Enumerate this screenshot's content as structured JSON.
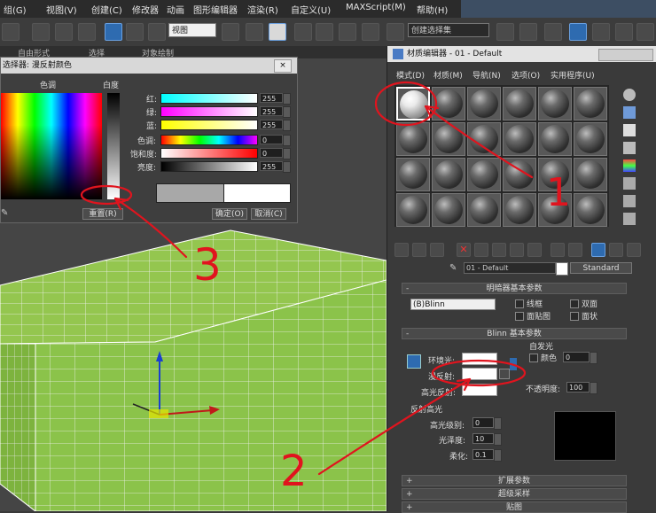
{
  "menubar": {
    "items": [
      "组(G)",
      "视图(V)",
      "创建(C)",
      "修改器",
      "动画",
      "图形编辑器",
      "渲染(R)",
      "自定义(U)",
      "MAXScript(M)",
      "帮助(H)"
    ]
  },
  "toolbar": {
    "view_combo": "视图",
    "selection_set_combo": "创建选择集"
  },
  "subbar": {
    "items": [
      "自由形式",
      "选择",
      "对象绘制"
    ]
  },
  "color_picker": {
    "title": "选择器: 漫反射颜色",
    "hue_label": "色调",
    "white_label": "白度",
    "rows": [
      {
        "label": "红:",
        "value": "255"
      },
      {
        "label": "绿:",
        "value": "255"
      },
      {
        "label": "蓝:",
        "value": "255"
      },
      {
        "label": "色调:",
        "value": "0"
      },
      {
        "label": "饱和度:",
        "value": "0"
      },
      {
        "label": "亮度:",
        "value": "255"
      }
    ],
    "reset_label": "重置(R)",
    "ok_label": "确定(O)",
    "cancel_label": "取消(C)",
    "close_label": "×"
  },
  "material_editor": {
    "title": "材质编辑器 - 01 - Default",
    "menu": [
      "模式(D)",
      "材质(M)",
      "导航(N)",
      "选项(O)",
      "实用程序(U)"
    ],
    "material_name": "01 - Default",
    "material_type": "Standard",
    "shader_rollout": {
      "title": "明暗器基本参数",
      "shader": "(B)Blinn",
      "options": [
        "线框",
        "双面",
        "面贴图",
        "面状"
      ]
    },
    "blinn_rollout": {
      "title": "Blinn 基本参数",
      "self_illum_title": "自发光",
      "color_label": "颜色",
      "self_illum_value": "0",
      "ambient_label": "环境光:",
      "diffuse_label": "漫反射:",
      "specular_label": "高光反射:",
      "opacity_label": "不透明度:",
      "opacity_value": "100",
      "spec_highlights_title": "反射高光",
      "spec_level_label": "高光级别:",
      "spec_level_value": "0",
      "glossiness_label": "光泽度:",
      "glossiness_value": "10",
      "soften_label": "柔化:",
      "soften_value": "0.1"
    },
    "extra_rollouts": [
      "扩展参数",
      "超级采样",
      "贴图"
    ]
  },
  "annotations": {
    "one": "1",
    "two": "2",
    "three": "3"
  },
  "colors": {
    "box_green": "#8bc34a",
    "accent": "#2e6bb0",
    "annotation_red": "#e0141e"
  }
}
